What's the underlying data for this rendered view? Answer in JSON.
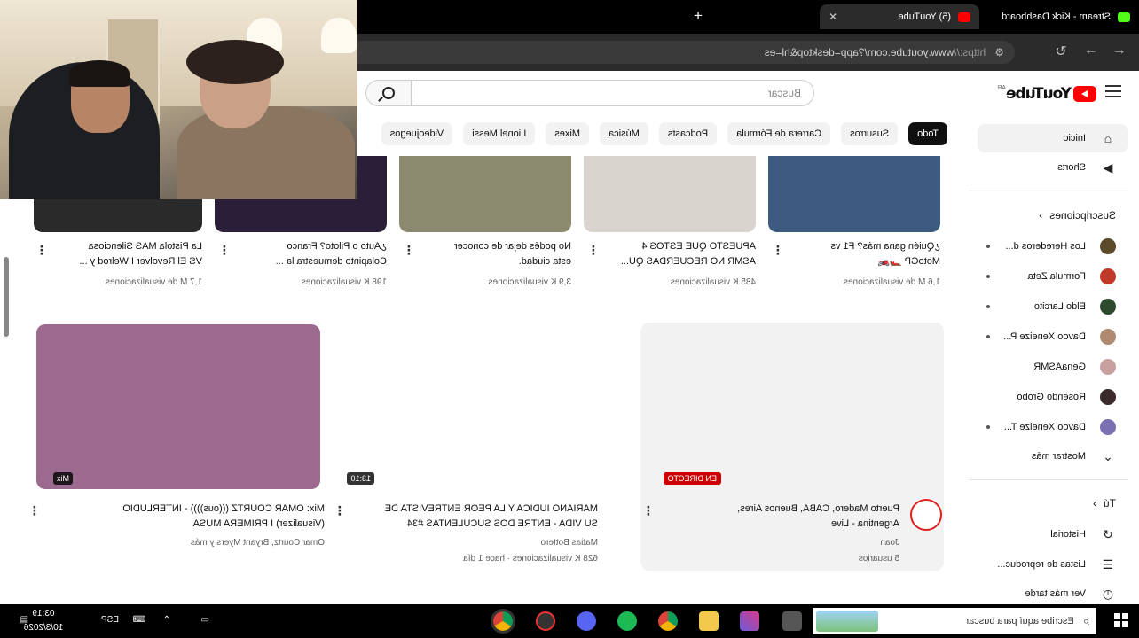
{
  "browser": {
    "tabs": [
      {
        "label": "(5) YouTube",
        "color": "#ff0000",
        "active": true
      },
      {
        "label": "Stream - Kick Dashboard",
        "color": "#53fc18",
        "active": false
      }
    ],
    "new_tab": "+",
    "close": "✕",
    "url_proto": "https://",
    "url_rest": "www.youtube.com/?app=desktop&hl=es"
  },
  "header": {
    "logo": "YouTube",
    "country": "AR",
    "search_placeholder": "Buscar"
  },
  "sidebar": {
    "main": [
      {
        "label": "Inicio",
        "icon": "home-icon"
      },
      {
        "label": "Shorts",
        "icon": "shorts-icon"
      }
    ],
    "subscriptions_title": "Suscripciones",
    "subscriptions": [
      {
        "label": "Los Herederos d...",
        "color": "#5a4a2a",
        "live": true
      },
      {
        "label": "Formula Zeta",
        "color": "#c0392b",
        "live": true
      },
      {
        "label": "Eldo Larcito",
        "color": "#2e4a2e",
        "live": true
      },
      {
        "label": "Davoo Xeneize P...",
        "color": "#b08a70",
        "live": true
      },
      {
        "label": "GenaASMR",
        "color": "#c9a0a0",
        "live": false
      },
      {
        "label": "Rosendo Grobo",
        "color": "#3a2a2a",
        "live": false
      },
      {
        "label": "Davoo Xeneize T...",
        "color": "#7a6fb0",
        "live": true
      }
    ],
    "show_more": "Mostrar más",
    "you_title": "Tú",
    "you": [
      {
        "label": "Historial",
        "icon": "history-icon"
      },
      {
        "label": "Listas de reproduc...",
        "icon": "playlist-icon"
      },
      {
        "label": "Ver más tarde",
        "icon": "clock-icon"
      }
    ]
  },
  "chips": [
    "Todo",
    "Susurros",
    "Carrera de Fórmula",
    "Podcasts",
    "Música",
    "Mixes",
    "Lionel Messi",
    "Videojuegos"
  ],
  "videos_row1": [
    {
      "title1": "¿Quién gana más? F1 vs",
      "title2": "MotoGP 🏎️🏍️",
      "meta": "1,6 M de visualizaciones",
      "thumb": "#3d5a80"
    },
    {
      "title1": "APUESTO QUE ESTOS 4",
      "title2": "ASMR NO RECUERDAS QU...",
      "meta": "485 K visualizaciones",
      "thumb": "#d9d4ce"
    },
    {
      "title1": "No podés dejar de conocer",
      "title2": "esta ciudad.",
      "meta": "3,9 K visualizaciones",
      "thumb": "#8c8a6e"
    },
    {
      "title1": "¿Auto o Piloto? Franco",
      "title2": "Colapinto demuestra la ...",
      "meta": "198 K visualizaciones",
      "thumb": "#2b1e38"
    },
    {
      "title1": "La Pistola MAS Silenciosa",
      "title2": "VS El Revolver I Welrod y ...",
      "meta": "1,7 M de visualizaciones",
      "thumb": "#2a2a2a"
    }
  ],
  "videos_row2": [
    {
      "title1": "Puerto Madero, CABA, Buenos Aires,",
      "title2": "Argentina - Live",
      "channel": "Joan",
      "meta": "5 usuarios",
      "badge": "EN DIRECTO",
      "thumb": "#f2f2f2"
    },
    {
      "title1": "MARIANO IUDICA Y LA PEOR ENTREVISTA DE",
      "title2": "SU VIDA - ENTRE DOS SUCULENTAS #34",
      "channel": "Matias Bottero",
      "meta": "628 K visualizaciones · hace 1 día",
      "badge": "13:10",
      "thumb": "#ffffff"
    },
    {
      "title1": "Mix: OMAR COURTZ (((ous)))) - INTERLUDIO",
      "title2": "(Visualizer) I PRIMERA MUSA",
      "channel": "Omar Courtz, Bryant Myers y más",
      "meta": "",
      "badge": "Mix",
      "thumb": "#9b6a8e"
    }
  ],
  "taskbar": {
    "search_placeholder": "Escribe aquí para buscar",
    "lang": "ESP",
    "time": "03:19",
    "date": "10/3/2026"
  }
}
